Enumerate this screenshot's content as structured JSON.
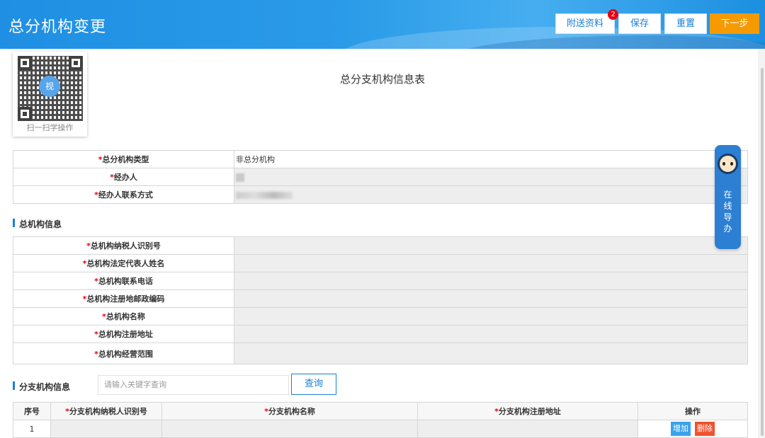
{
  "header": {
    "title": "总分机构变更",
    "buttons": {
      "attach": "附送资料",
      "save": "保存",
      "reset": "重置",
      "next": "下一步"
    },
    "badge_count": "2"
  },
  "qr": {
    "caption": "扫一扫学操作",
    "logo_text": "视"
  },
  "form_title": "总分支机构信息表",
  "basic": {
    "rows": [
      {
        "label": "总分机构类型",
        "value": "非总分机构"
      },
      {
        "label": "经办人",
        "value": ""
      },
      {
        "label": "经办人联系方式",
        "value": ""
      }
    ]
  },
  "hq": {
    "section_title": "总机构信息",
    "rows": [
      {
        "label": "总机构纳税人识别号"
      },
      {
        "label": "总机构法定代表人姓名"
      },
      {
        "label": "总机构联系电话"
      },
      {
        "label": "总机构注册地邮政编码"
      },
      {
        "label": "总机构名称"
      },
      {
        "label": "总机构注册地址"
      },
      {
        "label": "总机构经营范围"
      }
    ]
  },
  "branch": {
    "section_title": "分支机构信息",
    "search_placeholder": "请输入关键字查询",
    "query_label": "查询",
    "columns": [
      "序号",
      "分支机构纳税人识别号",
      "分支机构名称",
      "分支机构注册地址",
      "操作"
    ],
    "rows": [
      {
        "index": "1",
        "add_label": "增加",
        "delete_label": "删除"
      }
    ]
  },
  "guide": {
    "text": "在线导办"
  },
  "required_mark": "*"
}
